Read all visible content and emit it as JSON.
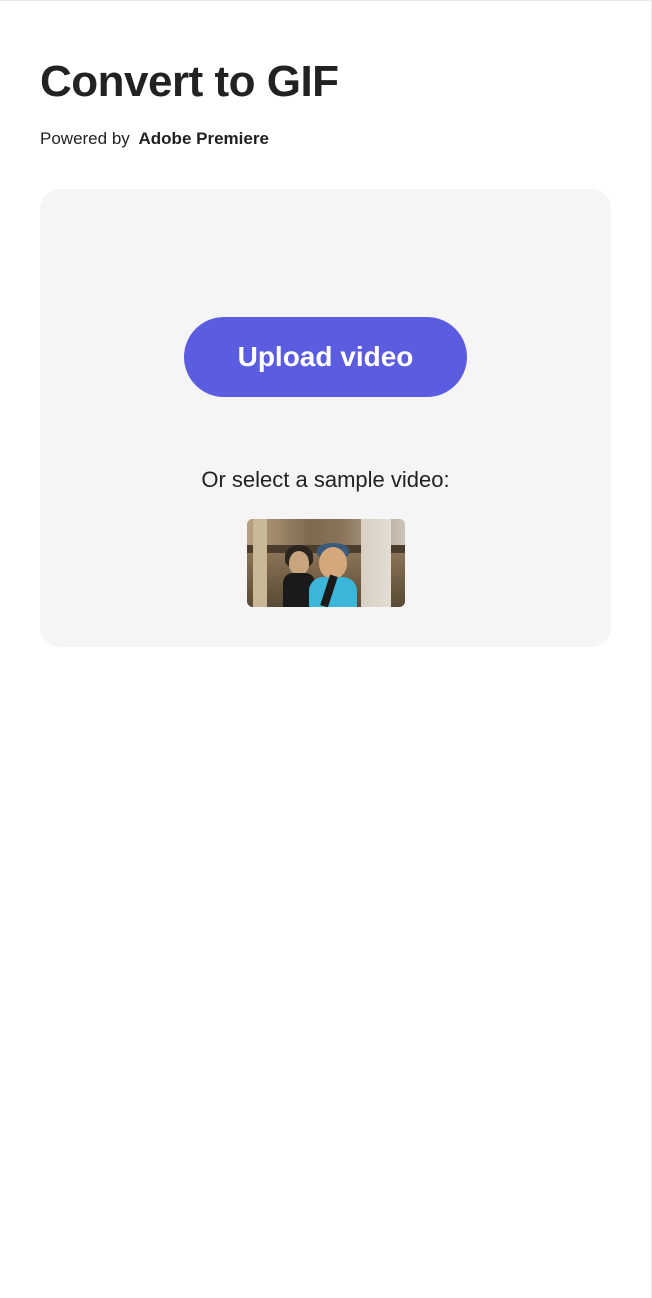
{
  "header": {
    "title": "Convert to GIF",
    "powered_by_prefix": "Powered by",
    "powered_by_brand": "Adobe Premiere"
  },
  "upload": {
    "button_label": "Upload video",
    "sample_label": "Or select a sample video:",
    "sample_thumb_name": "sample-video-thumbnail"
  },
  "colors": {
    "accent": "#5c5ce0",
    "panel_bg": "#f5f5f5"
  }
}
